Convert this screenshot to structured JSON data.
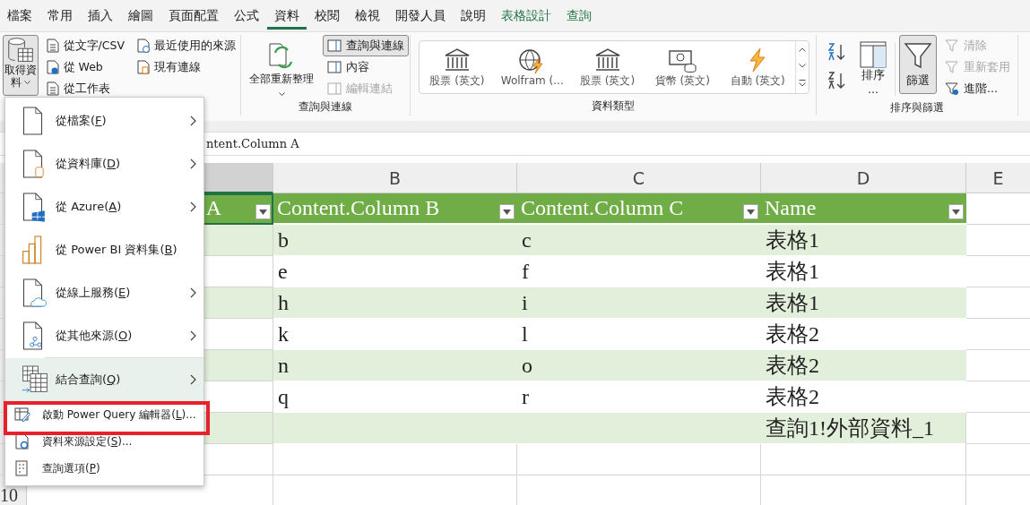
{
  "tabs": [
    {
      "label": "檔案",
      "selected": false,
      "contextual": false
    },
    {
      "label": "常用",
      "selected": false,
      "contextual": false
    },
    {
      "label": "插入",
      "selected": false,
      "contextual": false
    },
    {
      "label": "繪圖",
      "selected": false,
      "contextual": false
    },
    {
      "label": "頁面配置",
      "selected": false,
      "contextual": false
    },
    {
      "label": "公式",
      "selected": false,
      "contextual": false
    },
    {
      "label": "資料",
      "selected": true,
      "contextual": false
    },
    {
      "label": "校閱",
      "selected": false,
      "contextual": false
    },
    {
      "label": "檢視",
      "selected": false,
      "contextual": false
    },
    {
      "label": "開發人員",
      "selected": false,
      "contextual": false
    },
    {
      "label": "說明",
      "selected": false,
      "contextual": false
    },
    {
      "label": "表格設計",
      "selected": false,
      "contextual": true
    },
    {
      "label": "查詢",
      "selected": false,
      "contextual": true
    }
  ],
  "ribbon": {
    "get_data": {
      "big_button": {
        "line_1": "取得資",
        "line_2": "料",
        "pressed": true
      },
      "small_buttons": [
        {
          "label": "從文字/CSV"
        },
        {
          "label": "從 Web"
        },
        {
          "label": "從工作表"
        },
        {
          "label": "最近使用的來源"
        },
        {
          "label": "現有連線"
        }
      ]
    },
    "queries": {
      "label": "查詢與連線",
      "big_button": {
        "label": "全部重新整理"
      },
      "small_buttons": [
        {
          "label": "查詢與連線",
          "pressed": true,
          "disabled": false
        },
        {
          "label": "內容",
          "pressed": false,
          "disabled": false
        },
        {
          "label": "編輯連結",
          "pressed": false,
          "disabled": true
        }
      ]
    },
    "data_types": {
      "label": "資料類型",
      "items": [
        {
          "label": "股票 (英文)"
        },
        {
          "label": "Wolfram (..."
        },
        {
          "label": "股票 (英文)"
        },
        {
          "label": "貨幣 (英文)"
        },
        {
          "label": "自動 (英文)"
        }
      ]
    },
    "sort_filter": {
      "label": "排序與篩選",
      "sort_button": {
        "line_1": "排序",
        "line_2": "..."
      },
      "filter_button": {
        "label": "篩選",
        "pressed": true
      },
      "small_buttons": [
        {
          "label": "清除",
          "disabled": true
        },
        {
          "label": "重新套用",
          "disabled": true
        },
        {
          "label": "進階...",
          "disabled": false
        }
      ]
    }
  },
  "formula_bar": {
    "value": "ntent.Column A"
  },
  "sheet": {
    "columns": [
      {
        "label": "B",
        "selected": false
      },
      {
        "label": "C",
        "selected": false
      },
      {
        "label": "D",
        "selected": false
      },
      {
        "label": "E",
        "selected": false
      }
    ],
    "column_a_selected": true,
    "table_header": [
      "A",
      "Content.Column B",
      "Content.Column C",
      "Name"
    ],
    "rows": [
      {
        "column_b": "b",
        "column_c": "c",
        "name": "表格1"
      },
      {
        "column_b": "e",
        "column_c": "f",
        "name": "表格1"
      },
      {
        "column_b": "h",
        "column_c": "i",
        "name": "表格1"
      },
      {
        "column_b": "k",
        "column_c": "l",
        "name": "表格2"
      },
      {
        "column_b": "n",
        "column_c": "o",
        "name": "表格2"
      },
      {
        "column_b": "q",
        "column_c": "r",
        "name": "表格2"
      },
      {
        "name": "查詢1!外部資料_1"
      }
    ],
    "last_row_number": "10"
  },
  "menu": {
    "items": [
      {
        "kind": "large",
        "text": "從檔案(",
        "key": "F",
        "after": ")",
        "submenu": true,
        "highlighted": false
      },
      {
        "kind": "large",
        "text": "從資料庫(",
        "key": "D",
        "after": ")",
        "submenu": true,
        "highlighted": false
      },
      {
        "kind": "large",
        "text": "從 Azure(",
        "key": "A",
        "after": ")",
        "submenu": true,
        "highlighted": false
      },
      {
        "kind": "large",
        "text": "從 Power BI 資料集(",
        "key": "B",
        "after": ")",
        "submenu": false,
        "highlighted": false
      },
      {
        "kind": "large",
        "text": "從線上服務(",
        "key": "E",
        "after": ")",
        "submenu": true,
        "highlighted": false
      },
      {
        "kind": "large",
        "text": "從其他來源(",
        "key": "O",
        "after": ")",
        "submenu": true,
        "highlighted": false
      },
      {
        "kind": "large",
        "text": "結合查詢(",
        "key": "Q",
        "after": ")",
        "submenu": true,
        "highlighted": true
      },
      {
        "kind": "small",
        "text": "啟動 Power Query 編輯器(",
        "key": "L",
        "after": ")...",
        "submenu": false,
        "highlighted": false,
        "outlined": true
      },
      {
        "kind": "small",
        "text": "資料來源設定(",
        "key": "S",
        "after": ")...",
        "submenu": false,
        "highlighted": false,
        "outlined": false
      },
      {
        "kind": "small",
        "text": "查詢選項(",
        "key": "P",
        "after": ")",
        "submenu": false,
        "highlighted": false,
        "outlined": false
      }
    ]
  }
}
